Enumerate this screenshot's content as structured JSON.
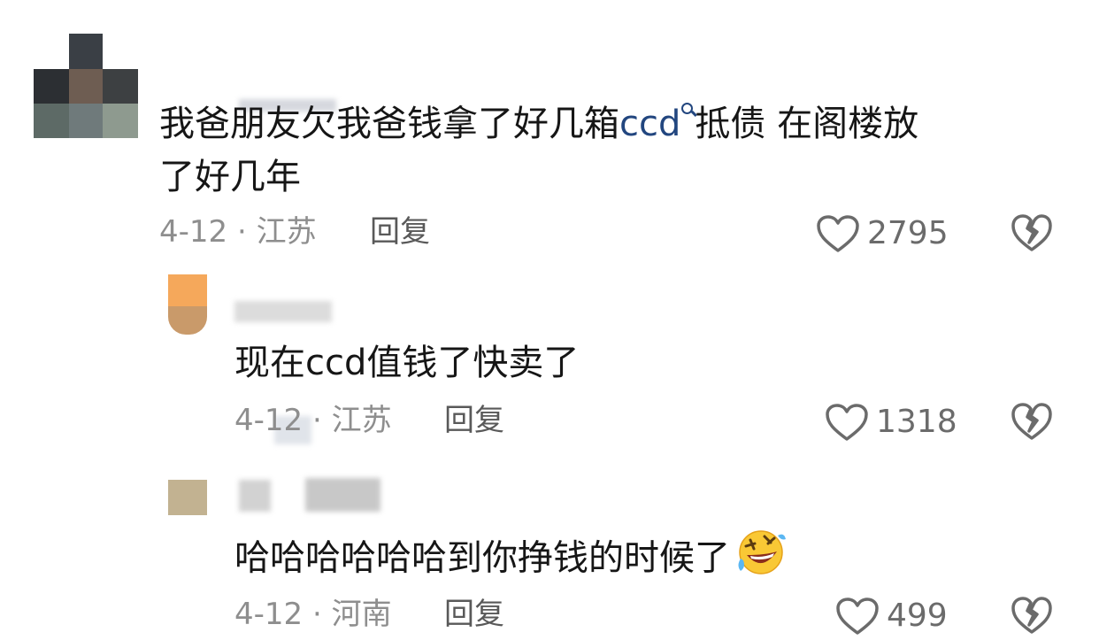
{
  "comments": [
    {
      "text_before": "我爸朋友欠我爸钱拿了好几箱",
      "keyword": "ccd",
      "text_after": "抵债 在阁楼放",
      "text_line2": "了好几年",
      "date_location": "4-12 · 江苏",
      "reply_label": "回复",
      "like_count": "2795"
    },
    {
      "text": "现在ccd值钱了快卖了",
      "date_location": "4-12 · 江苏",
      "reply_label": "回复",
      "like_count": "1318"
    },
    {
      "text": "哈哈哈哈哈哈到你挣钱的时候了",
      "emoji": "rolling-on-floor-laughing",
      "date_location": "4-12 · 河南",
      "reply_label": "回复",
      "like_count": "499"
    }
  ],
  "colors": {
    "keyword": "#22467f",
    "meta": "#8e8e8e",
    "text": "#161616"
  }
}
